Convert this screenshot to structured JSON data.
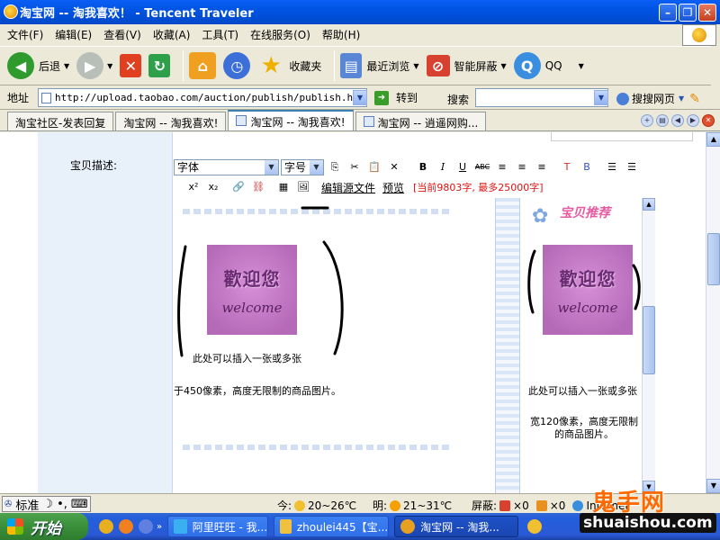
{
  "window": {
    "title": "淘宝网 -- 淘我喜欢！ - Tencent Traveler"
  },
  "menu": [
    "文件(F)",
    "编辑(E)",
    "查看(V)",
    "收藏(A)",
    "工具(T)",
    "在线服务(O)",
    "帮助(H)"
  ],
  "toolbar": {
    "back": "后退",
    "favorites": "收藏夹",
    "recent": "最近浏览",
    "smart_block": "智能屏蔽",
    "qq": "QQ"
  },
  "address": {
    "label": "地址",
    "url": "http://upload.taobao.com/auction/publish/publish.htm",
    "go": "转到",
    "search_label": "搜索",
    "search_web": "搜搜网页"
  },
  "tabs": [
    {
      "label": "淘宝社区-发表回复"
    },
    {
      "label": "淘宝网 -- 淘我喜欢!"
    },
    {
      "label": "淘宝网 -- 淘我喜欢!"
    },
    {
      "label": "淘宝网 -- 逍遥网购..."
    }
  ],
  "form": {
    "desc_label": "宝贝描述:"
  },
  "editor": {
    "font_select": "字体",
    "size_select": "字号",
    "edit_source": "编辑源文件",
    "preview": "预览",
    "counter": "[当前9803字, 最多25000字]",
    "bold": "B",
    "italic": "I",
    "underline": "U",
    "strike": "ABC",
    "superscript": "x²",
    "subscript": "x₂"
  },
  "content": {
    "welcome_big": "歡迎您",
    "welcome_script": "welcome",
    "caption1": "此处可以插入一张或多张",
    "caption2": "于450像素，高度无限制的商品图片。",
    "preview_title": "宝贝推荐",
    "preview_caption1": "此处可以插入一张或多张",
    "preview_caption2a": "宽120像素，高度无限制",
    "preview_caption2b": "的商品图片。"
  },
  "status": {
    "ime": "标准",
    "today_label": "今:",
    "today_temp": "20~26℃",
    "tomorrow_label": "明:",
    "tomorrow_temp": "21~31℃",
    "block_label": "屏蔽:",
    "block_count1": "×0",
    "block_count2": "×0",
    "zone": "Internet"
  },
  "watermark": {
    "brand": "鬼手网",
    "domain": "shuaishou.com"
  },
  "taskbar": {
    "start": "开始",
    "tasks": [
      {
        "label": "阿里旺旺 - 我..."
      },
      {
        "label": "zhoulei445【宝..."
      },
      {
        "label": "淘宝网 -- 淘我..."
      }
    ]
  },
  "colors": {
    "titlebar": "#0054e3",
    "counter": "#e01010",
    "welcome_tile": "#c37ac6",
    "start_button": "#3a8f3a"
  }
}
